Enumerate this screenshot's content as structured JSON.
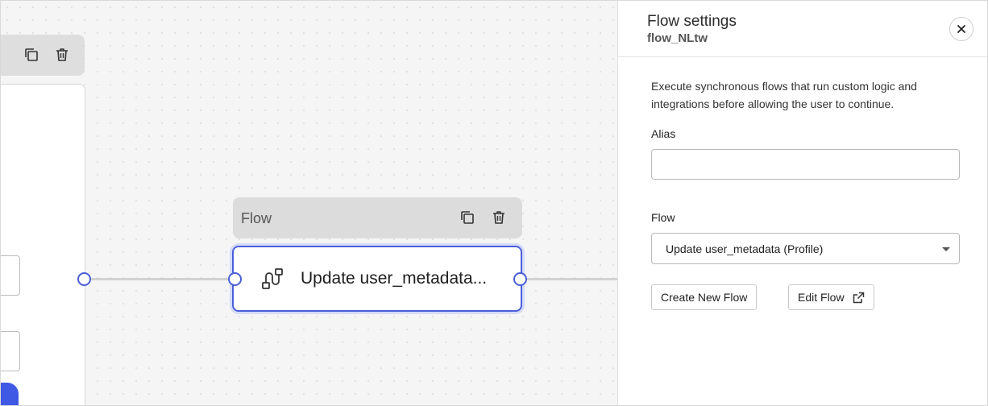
{
  "canvas": {
    "node": {
      "header_title": "Flow",
      "label": "Update user_metadata..."
    }
  },
  "panel": {
    "title": "Flow settings",
    "subtitle": "flow_NLtw",
    "description": "Execute synchronous flows that run custom logic and integrations before allowing the user to continue.",
    "alias": {
      "label": "Alias",
      "value": "",
      "placeholder": ""
    },
    "flow": {
      "label": "Flow",
      "selected": "Update user_metadata (Profile)"
    },
    "buttons": {
      "create": "Create New Flow",
      "edit": "Edit Flow"
    }
  },
  "colors": {
    "accent": "#4a5fd6",
    "canvas_bg": "#f5f5f6",
    "toolbar_bg": "#dcdcdc"
  },
  "icons": {
    "copy": "copy-icon",
    "delete": "trash-icon",
    "flow": "flow-icon",
    "close": "close-icon",
    "external": "external-link-icon",
    "caret": "chevron-down-icon"
  }
}
